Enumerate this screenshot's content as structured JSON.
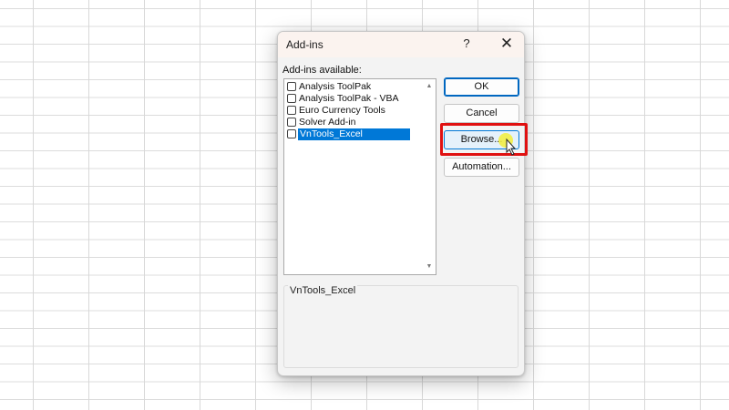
{
  "dialog": {
    "title": "Add-ins",
    "help_label": "?",
    "close_label": "✕",
    "list_label": "Add-ins available:",
    "items": [
      {
        "label": "Analysis ToolPak",
        "checked": false,
        "selected": false
      },
      {
        "label": "Analysis ToolPak - VBA",
        "checked": false,
        "selected": false
      },
      {
        "label": "Euro Currency Tools",
        "checked": false,
        "selected": false
      },
      {
        "label": "Solver Add-in",
        "checked": false,
        "selected": false
      },
      {
        "label": "VnTools_Excel",
        "checked": false,
        "selected": true
      }
    ],
    "buttons": {
      "ok": "OK",
      "cancel": "Cancel",
      "browse": "Browse...",
      "automation": "Automation..."
    },
    "description_label": "VnTools_Excel"
  },
  "colors": {
    "highlight": "#e01010",
    "selection": "#0078d7",
    "cursor_glow": "#f3ef3a"
  }
}
